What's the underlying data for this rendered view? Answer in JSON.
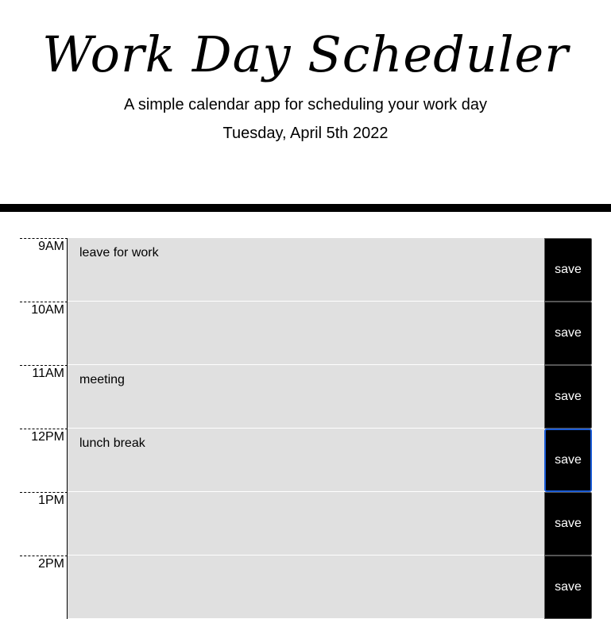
{
  "header": {
    "title": "Work Day Scheduler",
    "subtitle": "A simple calendar app for scheduling your work day",
    "current_day": "Tuesday, April 5th 2022"
  },
  "schedule": [
    {
      "hour": "9AM",
      "text": "leave for work",
      "save_label": "save"
    },
    {
      "hour": "10AM",
      "text": "",
      "save_label": "save"
    },
    {
      "hour": "11AM",
      "text": "meeting",
      "save_label": "save"
    },
    {
      "hour": "12PM",
      "text": "lunch break",
      "save_label": "save"
    },
    {
      "hour": "1PM",
      "text": "",
      "save_label": "save"
    },
    {
      "hour": "2PM",
      "text": "",
      "save_label": "save"
    }
  ],
  "colors": {
    "row_background": "#e0e0e0",
    "save_button": "#000000",
    "focus_ring": "#1a5bd6"
  }
}
